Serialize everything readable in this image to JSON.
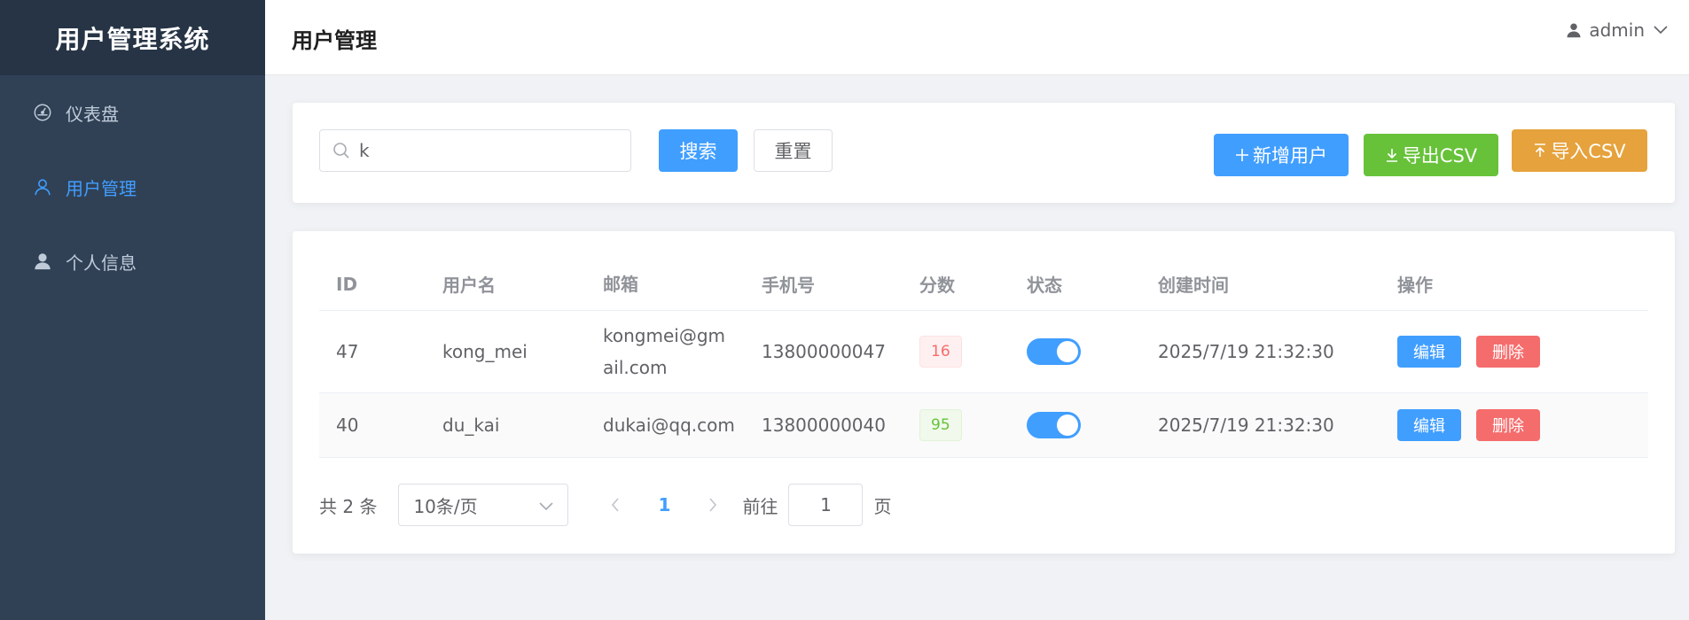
{
  "app": {
    "title": "用户管理系统"
  },
  "sidebar": {
    "items": [
      {
        "label": "仪表盘",
        "icon": "dashboard-icon",
        "active": false
      },
      {
        "label": "用户管理",
        "icon": "user-outline-icon",
        "active": true
      },
      {
        "label": "个人信息",
        "icon": "user-filled-icon",
        "active": false
      }
    ]
  },
  "header": {
    "title": "用户管理",
    "username": "admin"
  },
  "toolbar": {
    "search_value": "k",
    "search_label": "搜索",
    "reset_label": "重置",
    "add_label": "新增用户",
    "export_label": "导出CSV",
    "import_label": "导入CSV"
  },
  "table": {
    "columns": [
      "ID",
      "用户名",
      "邮箱",
      "手机号",
      "分数",
      "状态",
      "创建时间",
      "操作"
    ],
    "rows": [
      {
        "id": "47",
        "username": "kong_mei",
        "email": "kongmei@gmail.com",
        "phone": "13800000047",
        "score": "16",
        "status_on": true,
        "created": "2025/7/19 21:32:30",
        "edit": "编辑",
        "delete": "删除"
      },
      {
        "id": "40",
        "username": "du_kai",
        "email": "dukai@qq.com",
        "phone": "13800000040",
        "score": "95",
        "status_on": true,
        "created": "2025/7/19 21:32:30",
        "edit": "编辑",
        "delete": "删除"
      }
    ]
  },
  "pagination": {
    "total_text": "共 2 条",
    "page_size": "10条/页",
    "current_page": "1",
    "goto_label": "前往",
    "goto_value": "1",
    "page_suffix": "页"
  },
  "colors": {
    "primary": "#409eff",
    "success": "#67c23a",
    "warning": "#e6a23c",
    "danger": "#f56c6c",
    "sidebar_bg": "#304156"
  }
}
